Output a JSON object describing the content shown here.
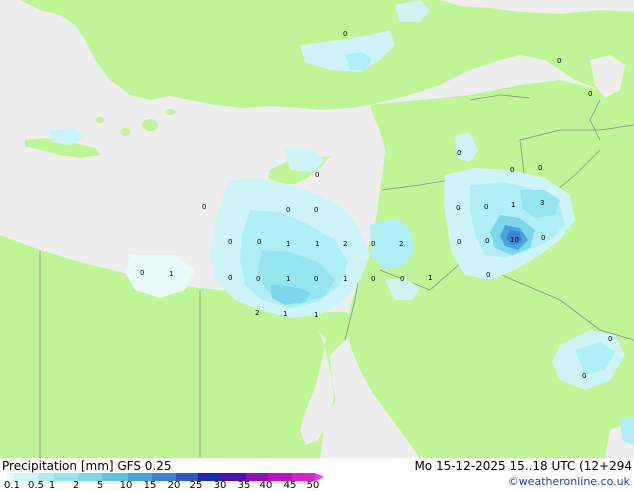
{
  "footer": {
    "title": "Precipitation [mm] GFS 0.25",
    "run_info": "Mo 15-12-2025 15..18 UTC (12+294",
    "credit": "©weatheronline.co.uk"
  },
  "legend": {
    "ticks": [
      "0.1",
      "0.5",
      "1",
      "2",
      "5",
      "10",
      "15",
      "20",
      "25",
      "30",
      "35",
      "40",
      "45",
      "50"
    ],
    "colors": [
      "#e8fafc",
      "#cdf5f9",
      "#b0eef6",
      "#96e4f0",
      "#7dd6ec",
      "#5ec2e6",
      "#4aa4dc",
      "#3a84d2",
      "#2e58c8",
      "#1a2ab8",
      "#5010b8",
      "#9010c0",
      "#c010c8",
      "#e020d0",
      "#ff30e0"
    ]
  },
  "colors": {
    "land": "#bff594",
    "sea": "#eeeeee",
    "border": "#8c8c8c"
  },
  "map_labels": [
    "0",
    "0",
    "0",
    "0",
    "0",
    "0",
    "0",
    "0",
    "0",
    "0",
    "0",
    "1",
    "0",
    "0",
    "1",
    "1",
    "2",
    "0",
    "2",
    "3",
    "0",
    "0",
    "10",
    "0",
    "0",
    "1",
    "0",
    "0",
    "1",
    "0",
    "1",
    "0",
    "0",
    "1",
    "0",
    "2",
    "1",
    "1",
    "0",
    "0",
    "0"
  ]
}
